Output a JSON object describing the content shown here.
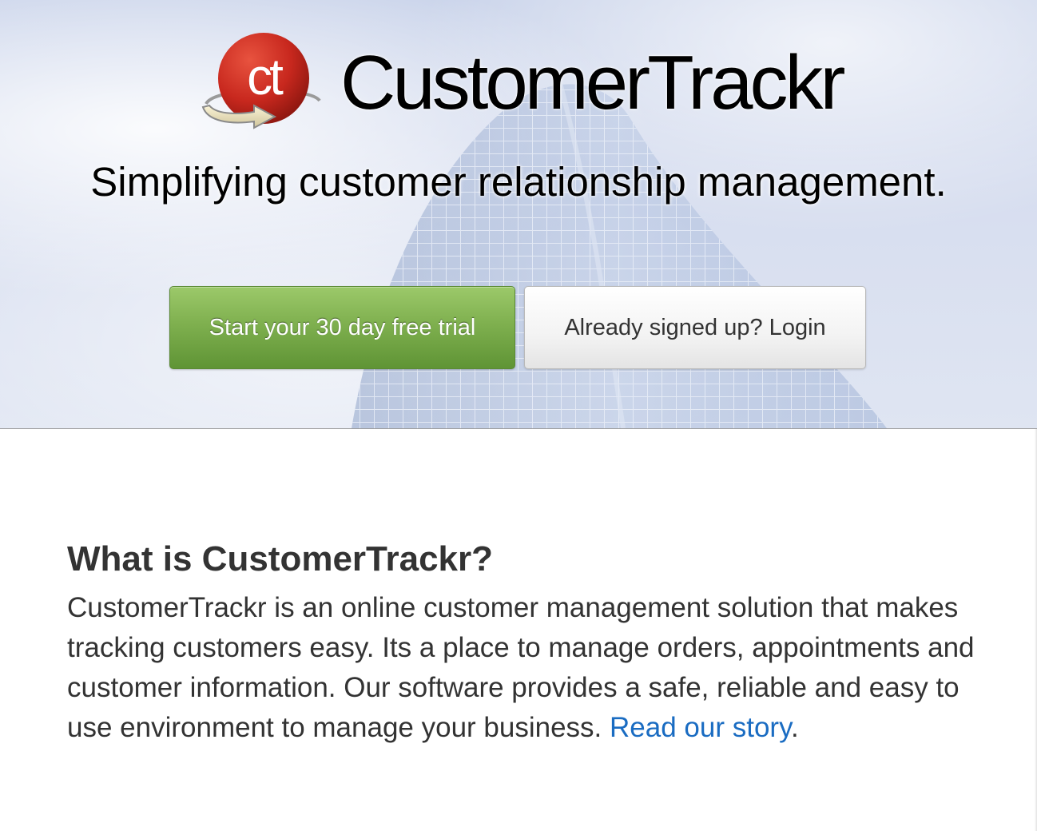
{
  "brand": {
    "logo_letters": "ct",
    "name": "CustomerTrackr"
  },
  "hero": {
    "tagline": "Simplifying customer relationship management.",
    "trial_button_label": "Start your 30 day free trial",
    "login_button_label": "Already signed up? Login"
  },
  "about": {
    "title": "What is CustomerTrackr?",
    "body": "CustomerTrackr is an online customer management solution that makes tracking customers easy. Its a place to manage orders, appointments and customer information. Our software provides a safe, reliable and easy to use environment to manage your business.",
    "link_label": "Read our story",
    "trailing_text": "."
  },
  "colors": {
    "brand_red": "#c8281e",
    "trial_green": "#7fb04f",
    "link_blue": "#1a6cc2",
    "text_dark": "#333333"
  },
  "icons": {
    "logo": "ct-circle-arrow-logo"
  }
}
